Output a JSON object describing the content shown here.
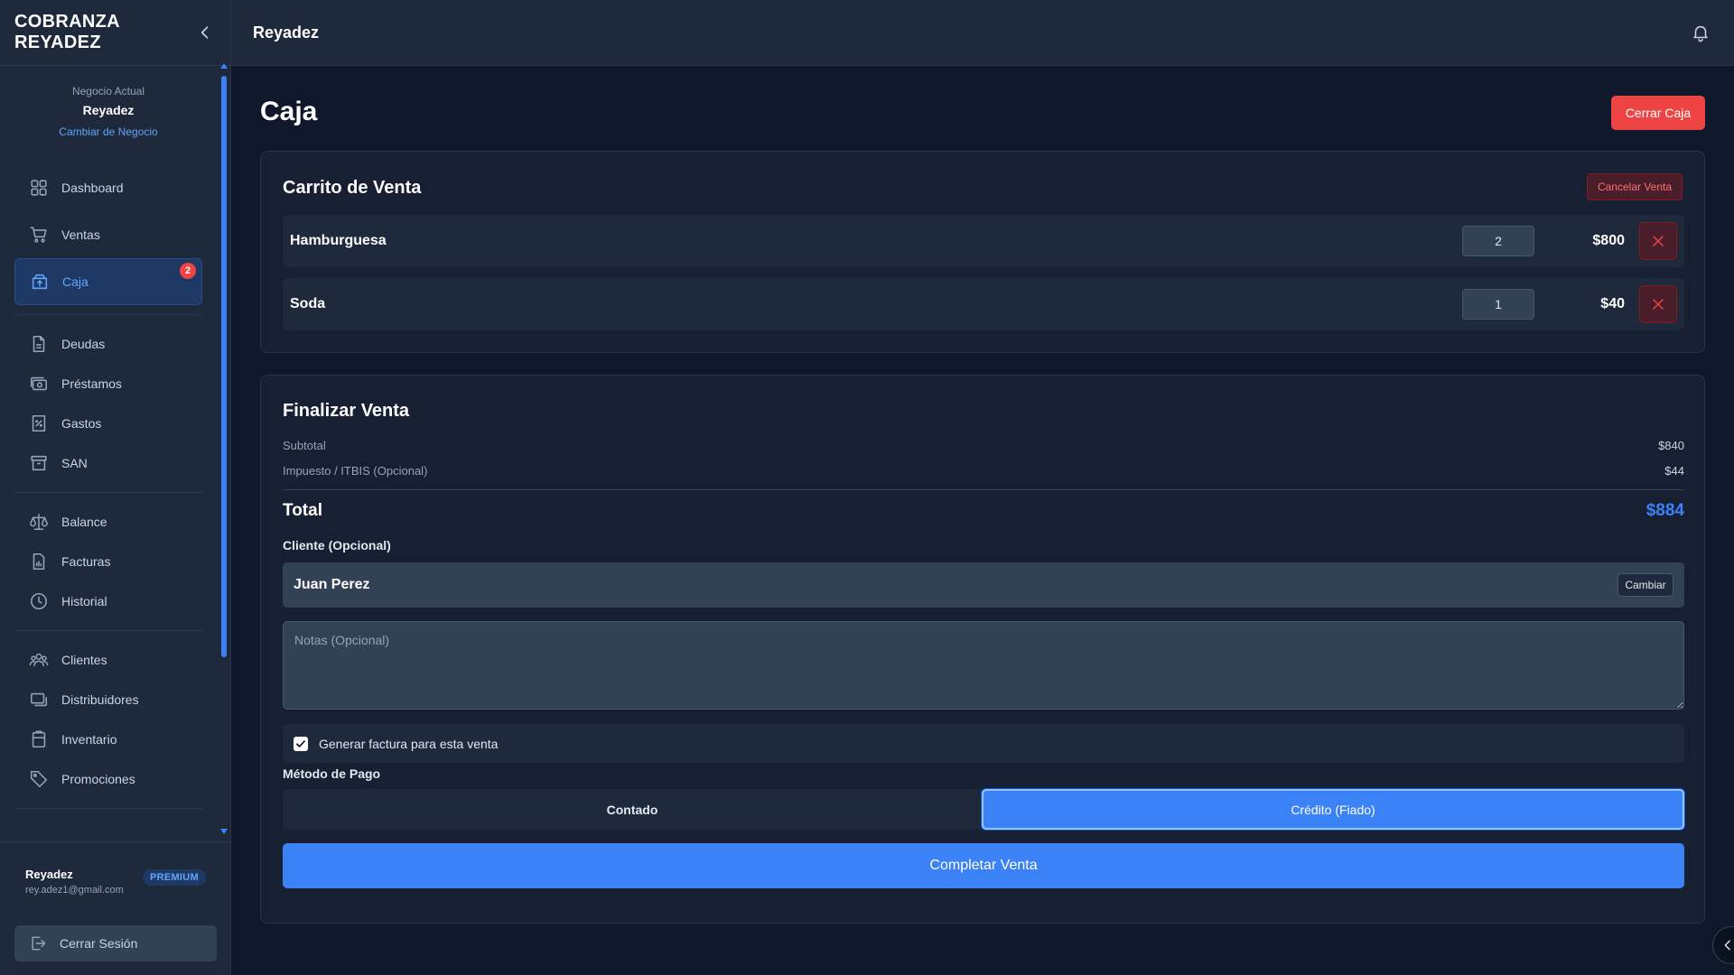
{
  "sidebar": {
    "brand": "COBRANZA REYADEZ",
    "business": {
      "caption": "Negocio Actual",
      "name": "Reyadez",
      "change_link": "Cambiar de Negocio"
    },
    "nav": {
      "dashboard": "Dashboard",
      "ventas": "Ventas",
      "caja": "Caja",
      "caja_badge": "2",
      "deudas": "Deudas",
      "prestamos": "Préstamos",
      "gastos": "Gastos",
      "san": "SAN",
      "balance": "Balance",
      "facturas": "Facturas",
      "historial": "Historial",
      "clientes": "Clientes",
      "distribuidores": "Distribuidores",
      "inventario": "Inventario",
      "promociones": "Promociones"
    },
    "user": {
      "name": "Reyadez",
      "email": "rey.adez1@gmail.com",
      "plan": "PREMIUM"
    },
    "logout_label": "Cerrar Sesión"
  },
  "topbar": {
    "title": "Reyadez"
  },
  "page": {
    "title": "Caja",
    "close_cash_label": "Cerrar Caja"
  },
  "cart": {
    "title": "Carrito de Venta",
    "cancel_label": "Cancelar Venta",
    "items": [
      {
        "name": "Hamburguesa",
        "qty": "2",
        "price": "$800"
      },
      {
        "name": "Soda",
        "qty": "1",
        "price": "$40"
      }
    ]
  },
  "checkout": {
    "title": "Finalizar Venta",
    "subtotal_label": "Subtotal",
    "subtotal_value": "$840",
    "tax_label": "Impuesto / ITBIS (Opcional)",
    "tax_value": "$44",
    "total_label": "Total",
    "total_value": "$884",
    "client_label": "Cliente (Opcional)",
    "client_name": "Juan Perez",
    "change_client_label": "Cambiar",
    "notes_placeholder": "Notas (Opcional)",
    "invoice_label": "Generar factura para esta venta",
    "invoice_checked": true,
    "payment_label": "Método de Pago",
    "payment_cash": "Contado",
    "payment_credit": "Crédito (Fiado)",
    "payment_selected": "credit",
    "complete_label": "Completar Venta"
  },
  "colors": {
    "accent": "#3b82f6",
    "danger": "#ef4444",
    "background": "#0f172a",
    "surface": "#1e293b"
  }
}
